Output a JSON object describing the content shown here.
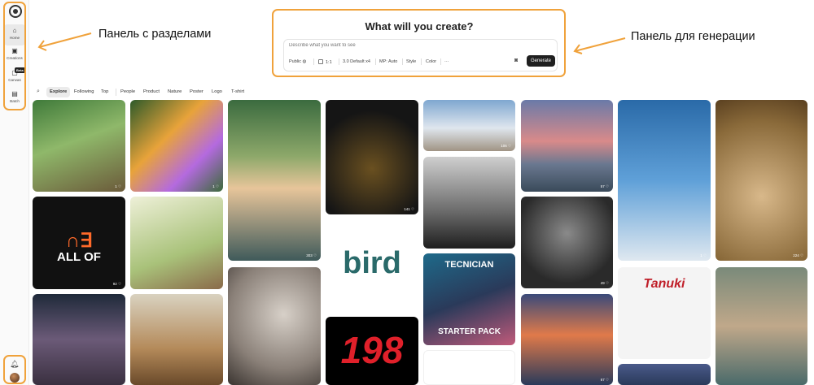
{
  "sidebar": {
    "items": [
      {
        "label": "Home",
        "icon": "home-icon"
      },
      {
        "label": "Creations",
        "icon": "creations-icon"
      },
      {
        "label": "Canvas",
        "icon": "canvas-icon"
      },
      {
        "label": "Batch",
        "icon": "batch-icon"
      }
    ],
    "canvas_badge": "Beta"
  },
  "annotations": {
    "left_label": "Панель с разделами",
    "right_label": "Панель для генерации",
    "highlight_color": "#f0a23b"
  },
  "generator": {
    "title": "What will you create?",
    "placeholder": "Describe what you want to see",
    "options": {
      "visibility": "Public",
      "ratio": "1:1",
      "model": "3.0 Default x4",
      "mp_label": "MP:",
      "mp_value": "Auto",
      "style": "Style",
      "color": "Color",
      "more": "···"
    },
    "generate_label": "Generate"
  },
  "filters": {
    "tabs": [
      "Explore",
      "Following",
      "Top",
      "People",
      "Product",
      "Nature",
      "Poster",
      "Logo",
      "T-shirt"
    ],
    "active": "Explore"
  },
  "gallery": {
    "tiles": [
      {
        "count": "1 ♡",
        "text": ""
      },
      {
        "count": "1 ♡",
        "text": ""
      },
      {
        "count": "303 ♡",
        "text": ""
      },
      {
        "count": "141 ♡",
        "text": ""
      },
      {
        "count": "106 ♡",
        "text": ""
      },
      {
        "count": "57 ♡",
        "text": ""
      },
      {
        "count": "1 ♡",
        "text": ""
      },
      {
        "count": "224 ♡",
        "text": ""
      },
      {
        "count": "92 ♡",
        "text": "ALL OF"
      },
      {
        "count": "",
        "text": ""
      },
      {
        "count": "",
        "text": "bird"
      },
      {
        "count": "",
        "text": ""
      },
      {
        "count": "49 ♡",
        "text": ""
      },
      {
        "count": "",
        "text": "TECNICIAN"
      },
      {
        "count": "",
        "text": "STARTER PACK"
      },
      {
        "count": "",
        "text": "Tanuki"
      },
      {
        "count": "",
        "text": ""
      },
      {
        "count": "",
        "text": ""
      },
      {
        "count": "",
        "text": ""
      },
      {
        "count": "",
        "text": ""
      },
      {
        "count": "67 ♡",
        "text": ""
      },
      {
        "count": "",
        "text": "198"
      }
    ]
  }
}
